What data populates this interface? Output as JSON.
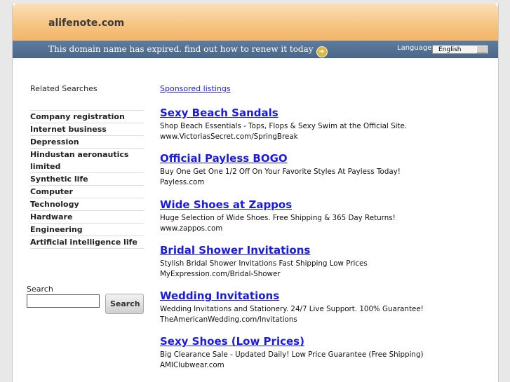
{
  "header": {
    "site_name": "alifenote.com",
    "expired_text": "This domain name has expired. find out how to renew it today",
    "expired_icon": "arrow-circle-icon",
    "language_label": "Language:",
    "language_value": "English"
  },
  "related": {
    "title": "Related Searches",
    "items": [
      "Company registration",
      "Internet business",
      "Depression",
      "Hindustan aeronautics limited",
      "Synthetic life",
      "Computer",
      "Technology",
      "Hardware",
      "Engineering",
      "Artificial intelligence life"
    ]
  },
  "search": {
    "label": "Search",
    "button": "Search",
    "value": ""
  },
  "sponsored_label": "Sponsored listings",
  "ads": [
    {
      "title": "Sexy Beach Sandals",
      "desc": "Shop Beach Essentials - Tops, Flops & Sexy Swim at the Official Site.",
      "url": "www.VictoriasSecret.com/SpringBreak"
    },
    {
      "title": "Official Payless BOGO",
      "desc": "Buy One Get One 1/2 Off On Your Favorite Styles At Payless Today!",
      "url": "Payless.com"
    },
    {
      "title": "Wide Shoes at Zappos",
      "desc": "Huge Selection of Wide Shoes. Free Shipping & 365 Day Returns!",
      "url": "www.zappos.com"
    },
    {
      "title": "Bridal Shower Invitations",
      "desc": "Stylish Bridal Shower Invitations Fast Shipping Low Prices",
      "url": "MyExpression.com/Bridal-Shower"
    },
    {
      "title": "Wedding Invitations",
      "desc": "Wedding Invitations and Stationery. 24/7 Live Support. 100% Guarantee!",
      "url": "TheAmericanWedding.com/Invitations"
    },
    {
      "title": "Sexy Shoes (Low Prices)",
      "desc": "Big Clearance Sale - Updated Daily! Low Price Guarantee (Free Shipping)",
      "url": "AMIClubwear.com"
    }
  ]
}
